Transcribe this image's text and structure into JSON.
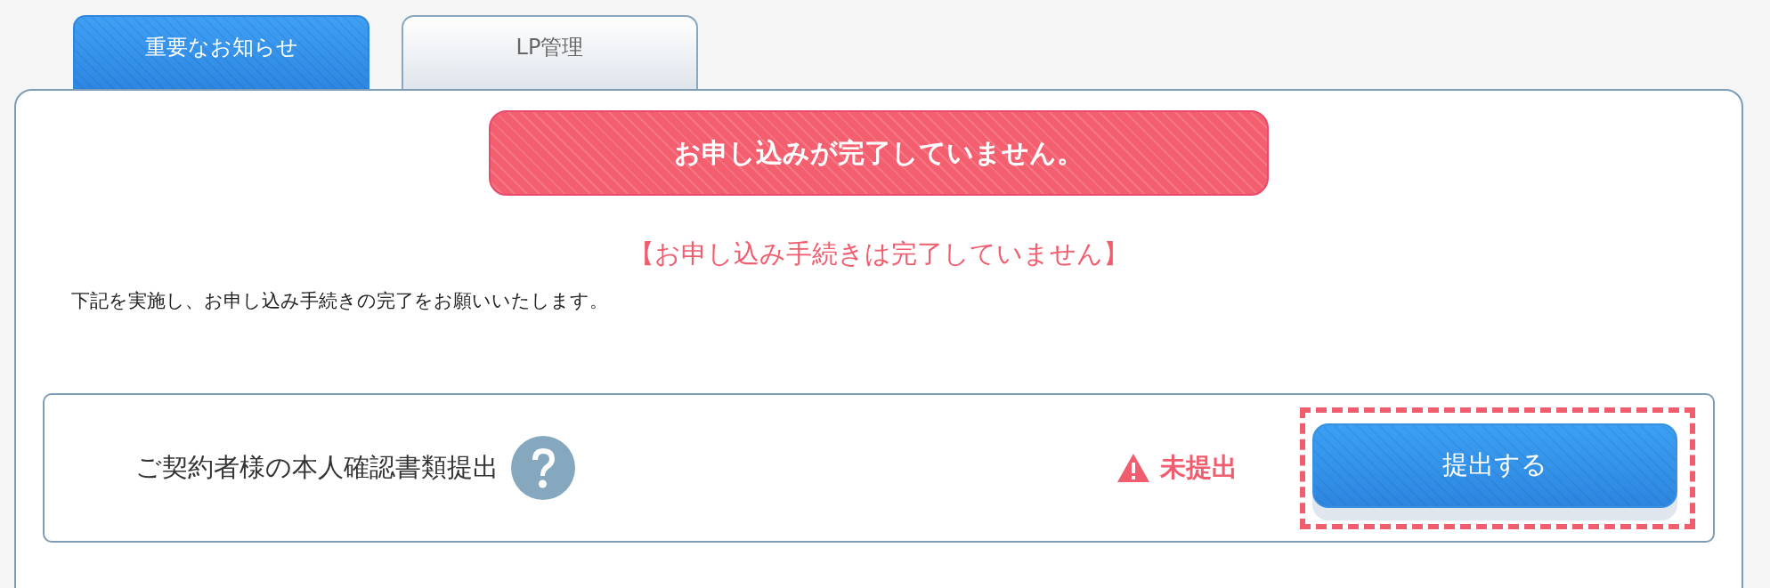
{
  "tabs": [
    {
      "label": "重要なお知らせ",
      "selected": true
    },
    {
      "label": "LP管理",
      "selected": false
    }
  ],
  "banner": "お申し込みが完了していません。",
  "heading": "【お申し込み手続きは完了していません】",
  "message": "下記を実施し、お申し込み手続きの完了をお願いいたします。",
  "tasks": [
    {
      "label": "ご契約者様の本人確認書類提出",
      "status": "未提出",
      "submitted": false,
      "highlighted": true,
      "button": "提出する"
    }
  ]
}
